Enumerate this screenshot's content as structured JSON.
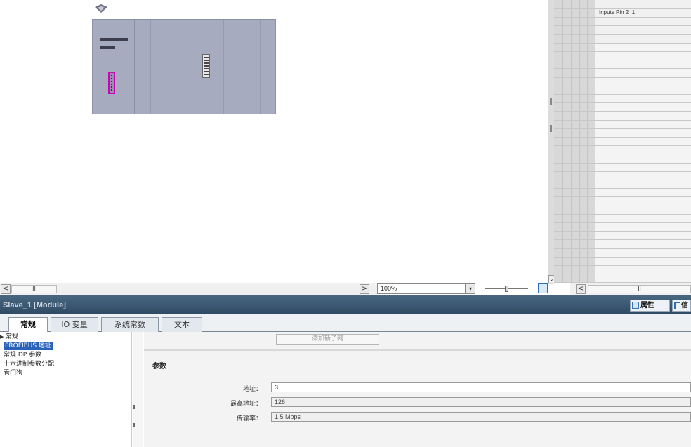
{
  "canvas": {
    "zoom": "100%",
    "zoom_options": [
      "100%"
    ],
    "hscroll_thumb": "II",
    "scroll_left": "<",
    "scroll_right": ">",
    "dropdown_arrow": "▾",
    "vscroll_down": "⌄",
    "device": {
      "tag_icon": "device-tag-icon",
      "profibus_port_color": "#d000b8",
      "body_color": "#a6abc0"
    }
  },
  "overview": {
    "header": "Inputs Pin 2_1",
    "scroll_left": "<",
    "hscroll_thumb": "II"
  },
  "inspector": {
    "title": "Slave_1 [Module]",
    "properties_tab": "属性",
    "info_tab": "信",
    "tabs": [
      {
        "label": "常规"
      },
      {
        "label": "IO 变量"
      },
      {
        "label": "系统常数"
      },
      {
        "label": "文本"
      }
    ],
    "nav": {
      "items": [
        {
          "label": "常规"
        },
        {
          "label": "PROFIBUS 地址"
        },
        {
          "label": "常规 DP 参数"
        },
        {
          "label": "十六进制参数分配"
        },
        {
          "label": "看门狗"
        }
      ]
    },
    "content": {
      "add_subnet": "添加新子网",
      "section_title": "参数",
      "fields": {
        "address_label": "地址：",
        "address_value": "3",
        "highest_label": "最高地址：",
        "highest_value": "126",
        "rate_label": "传输率：",
        "rate_value": "1.5 Mbps"
      }
    }
  },
  "colors": {
    "title_bar": "#3a5670",
    "selected": "#2a62b9"
  }
}
